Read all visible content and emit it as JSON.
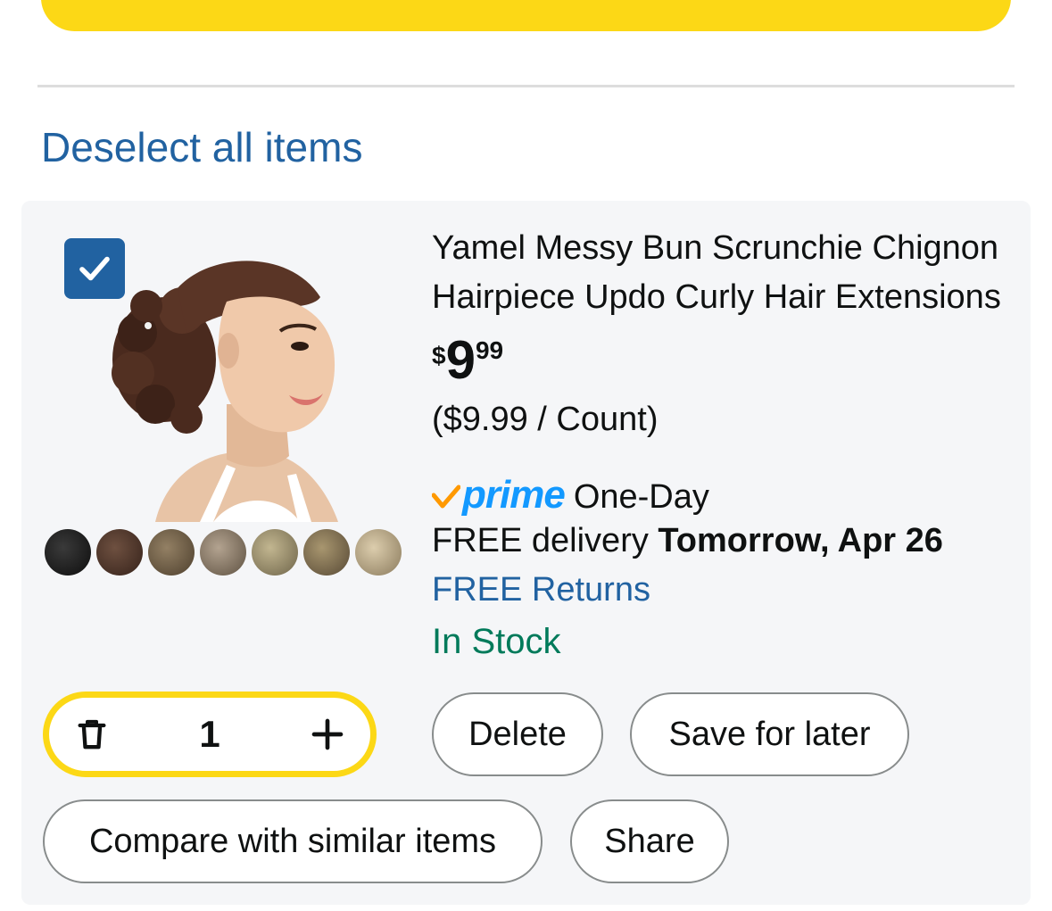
{
  "colors": {
    "accent_yellow": "#fcd816",
    "link_blue": "#2162a1",
    "prime_blue": "#1399ff",
    "prime_orange": "#ff9900",
    "in_stock_green": "#007a5a",
    "card_bg": "#f5f6f8"
  },
  "cart": {
    "deselect_label": "Deselect all items"
  },
  "item": {
    "selected": true,
    "image_icon": "product-photo-messy-bun",
    "swatch_colors": [
      "#1b1b1b",
      "#4a3428",
      "#6b5a45",
      "#8a7a66",
      "#9a8f70",
      "#7d6e55",
      "#b9a889"
    ],
    "title": "Yamel Messy Bun Scrunchie Chignon Hairpiece Updo Curly Hair Extensions",
    "price": {
      "symbol": "$",
      "whole": "9",
      "fraction": "99"
    },
    "unit_price": "($9.99 / Count)",
    "prime": {
      "logo_text": "prime",
      "label": "One-Day"
    },
    "delivery": {
      "prefix": "FREE delivery",
      "date": "Tomorrow, Apr 26"
    },
    "returns_label": "FREE Returns",
    "stock_status": "In Stock",
    "quantity": "1",
    "actions": {
      "delete": "Delete",
      "save_for_later": "Save for later",
      "compare": "Compare with similar items",
      "share": "Share"
    }
  }
}
